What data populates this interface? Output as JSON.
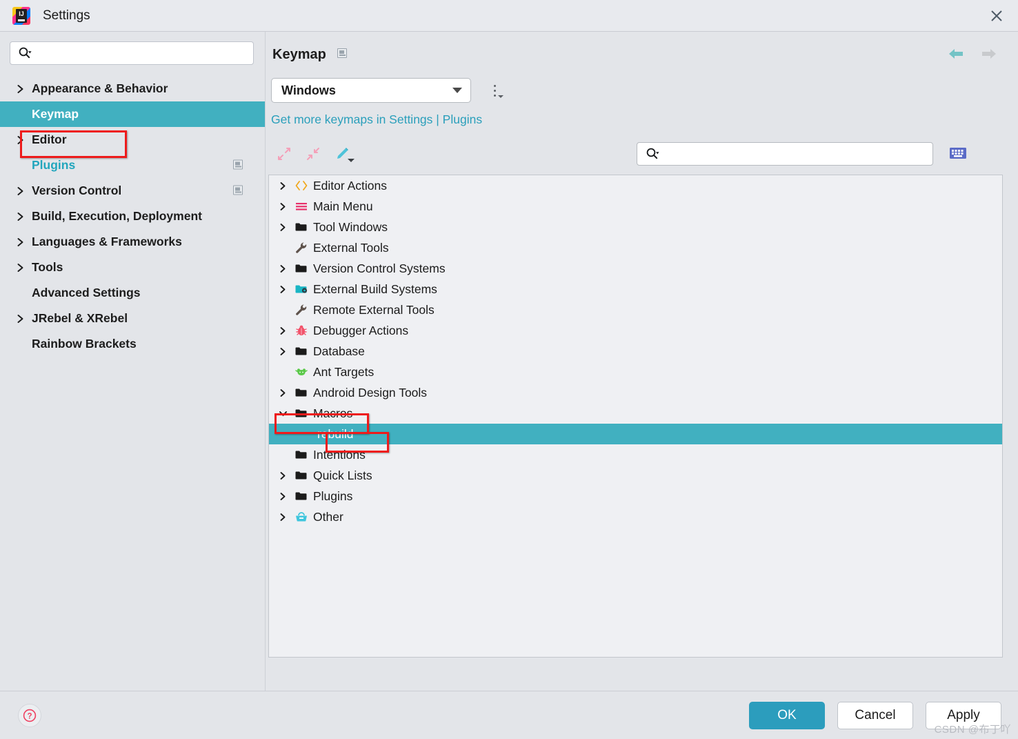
{
  "window": {
    "title": "Settings",
    "app_icon": "intellij-idea-logo",
    "close_icon": "close-icon"
  },
  "sidebar": {
    "search": {
      "placeholder": "",
      "value": "",
      "icon": "search-icon"
    },
    "items": [
      {
        "label": "Appearance & Behavior",
        "expandable": true,
        "selected": false,
        "link": false,
        "sync": false
      },
      {
        "label": "Keymap",
        "expandable": false,
        "selected": true,
        "link": false,
        "sync": false
      },
      {
        "label": "Editor",
        "expandable": true,
        "selected": false,
        "link": false,
        "sync": false
      },
      {
        "label": "Plugins",
        "expandable": false,
        "selected": false,
        "link": true,
        "sync": true
      },
      {
        "label": "Version Control",
        "expandable": true,
        "selected": false,
        "link": false,
        "sync": true
      },
      {
        "label": "Build, Execution, Deployment",
        "expandable": true,
        "selected": false,
        "link": false,
        "sync": false
      },
      {
        "label": "Languages & Frameworks",
        "expandable": true,
        "selected": false,
        "link": false,
        "sync": false
      },
      {
        "label": "Tools",
        "expandable": true,
        "selected": false,
        "link": false,
        "sync": false
      },
      {
        "label": "Advanced Settings",
        "expandable": false,
        "selected": false,
        "link": false,
        "sync": false
      },
      {
        "label": "JRebel & XRebel",
        "expandable": true,
        "selected": false,
        "link": false,
        "sync": false
      },
      {
        "label": "Rainbow Brackets",
        "expandable": false,
        "selected": false,
        "link": false,
        "sync": false
      }
    ]
  },
  "content": {
    "title": "Keymap",
    "title_badge_icon": "settings-sync-icon",
    "nav": {
      "back_icon": "arrow-left-icon",
      "forward_icon": "arrow-right-icon"
    },
    "keymap_select": {
      "value": "Windows",
      "caret_icon": "chevron-down-icon"
    },
    "kebab_icon": "more-options-icon",
    "more_link": "Get more keymaps in Settings | Plugins",
    "toolbar": {
      "expand_all_icon": "expand-all-icon",
      "collapse_all_icon": "collapse-all-icon",
      "edit_shortcut_icon": "edit-pencil-icon",
      "search": {
        "placeholder": "",
        "value": "",
        "icon": "search-icon"
      },
      "keyboard_icon": "keyboard-icon"
    },
    "tree": [
      {
        "label": "Editor Actions",
        "icon": "code-brackets-icon",
        "expandable": true,
        "expanded": false,
        "selected": false,
        "child": false
      },
      {
        "label": "Main Menu",
        "icon": "menu-lines-icon",
        "expandable": true,
        "expanded": false,
        "selected": false,
        "child": false
      },
      {
        "label": "Tool Windows",
        "icon": "folder-icon",
        "expandable": true,
        "expanded": false,
        "selected": false,
        "child": false
      },
      {
        "label": "External Tools",
        "icon": "wrench-icon",
        "expandable": false,
        "expanded": false,
        "selected": false,
        "child": false
      },
      {
        "label": "Version Control Systems",
        "icon": "folder-icon",
        "expandable": true,
        "expanded": false,
        "selected": false,
        "child": false
      },
      {
        "label": "External Build Systems",
        "icon": "folder-gear-icon",
        "expandable": true,
        "expanded": false,
        "selected": false,
        "child": false
      },
      {
        "label": "Remote External Tools",
        "icon": "wrench-icon",
        "expandable": false,
        "expanded": false,
        "selected": false,
        "child": false
      },
      {
        "label": "Debugger Actions",
        "icon": "bug-icon",
        "expandable": true,
        "expanded": false,
        "selected": false,
        "child": false
      },
      {
        "label": "Database",
        "icon": "folder-icon",
        "expandable": true,
        "expanded": false,
        "selected": false,
        "child": false
      },
      {
        "label": "Ant Targets",
        "icon": "ant-icon",
        "expandable": false,
        "expanded": false,
        "selected": false,
        "child": false
      },
      {
        "label": "Android Design Tools",
        "icon": "folder-icon",
        "expandable": true,
        "expanded": false,
        "selected": false,
        "child": false
      },
      {
        "label": "Macros",
        "icon": "folder-icon",
        "expandable": true,
        "expanded": true,
        "selected": false,
        "child": false
      },
      {
        "label": "rebuild",
        "icon": "none",
        "expandable": false,
        "expanded": false,
        "selected": true,
        "child": true
      },
      {
        "label": "Intentions",
        "icon": "folder-icon",
        "expandable": false,
        "expanded": false,
        "selected": false,
        "child": false
      },
      {
        "label": "Quick Lists",
        "icon": "folder-icon",
        "expandable": true,
        "expanded": false,
        "selected": false,
        "child": false
      },
      {
        "label": "Plugins",
        "icon": "folder-icon",
        "expandable": true,
        "expanded": false,
        "selected": false,
        "child": false
      },
      {
        "label": "Other",
        "icon": "basket-icon",
        "expandable": true,
        "expanded": false,
        "selected": false,
        "child": false
      }
    ]
  },
  "footer": {
    "help_icon": "help-question-icon",
    "ok_label": "OK",
    "cancel_label": "Cancel",
    "apply_label": "Apply"
  },
  "watermark": "CSDN @布丁吖",
  "colors": {
    "accent_teal": "#41b0c0",
    "primary_button": "#2c9dbd",
    "link": "#2a9fbb",
    "annotation_red": "#ee1b1b",
    "window_bg": "#e3e5e9",
    "panel_bg": "#eff0f3"
  }
}
